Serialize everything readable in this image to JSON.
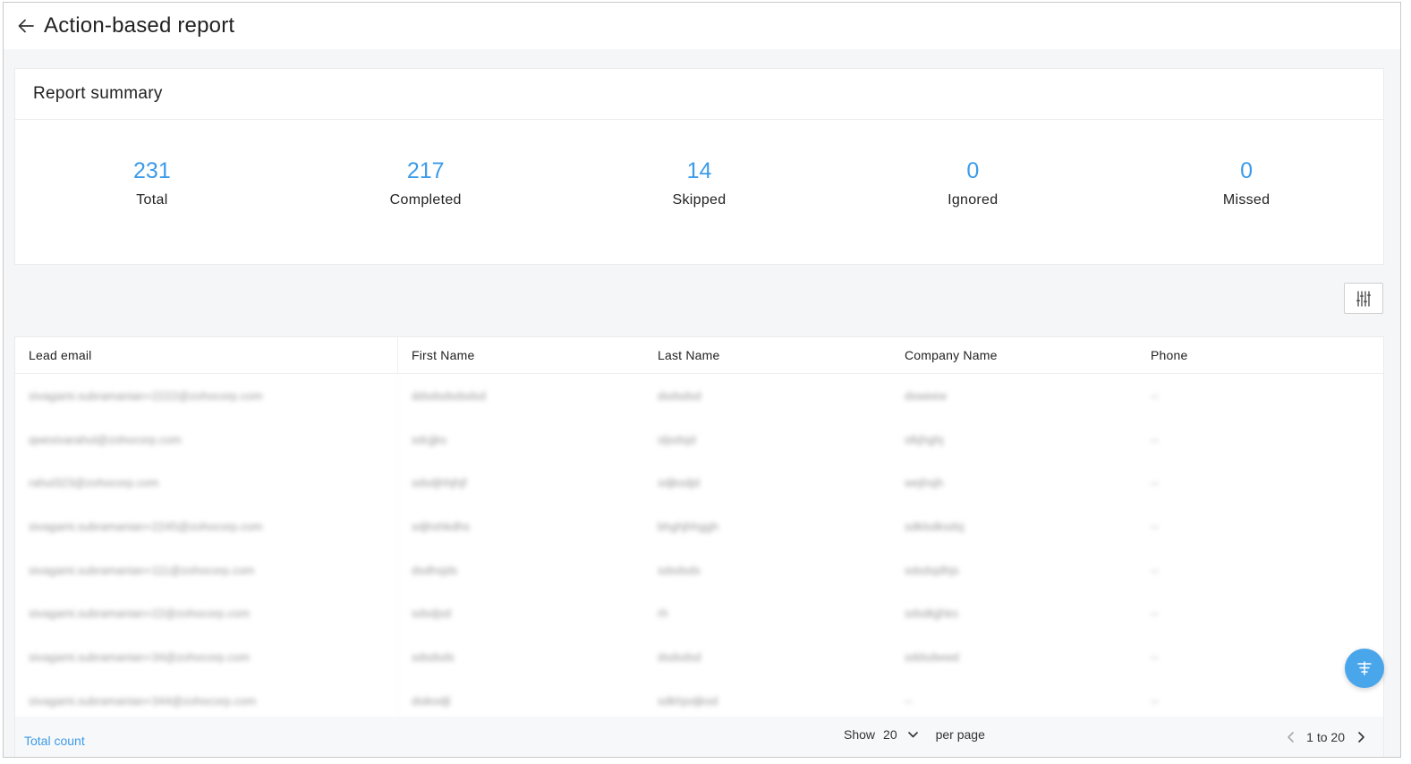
{
  "header": {
    "title": "Action-based report",
    "back_icon": "arrow-left-icon"
  },
  "summary": {
    "title": "Report summary",
    "stats": [
      {
        "value": "231",
        "label": "Total"
      },
      {
        "value": "217",
        "label": "Completed"
      },
      {
        "value": "14",
        "label": "Skipped"
      },
      {
        "value": "0",
        "label": "Ignored"
      },
      {
        "value": "0",
        "label": "Missed"
      }
    ]
  },
  "table": {
    "columns": [
      "Lead email",
      "First Name",
      "Last Name",
      "Company Name",
      "Phone"
    ],
    "rows": [
      [
        "sivagami.subramanian+2222@zohocorp.com",
        "ddsdsdsdsdsd",
        "dsdsdsd",
        "dsweew",
        "--"
      ],
      [
        "qwesivarahul@zohocorp.com",
        "sdcjjks",
        "sljsdsjd",
        "slkjhghj",
        "--"
      ],
      [
        "rahul323@zohocorp.com",
        "sdsdjhhjhjf",
        "sdjksdjd",
        "wejhsjh",
        "--"
      ],
      [
        "sivagami.subramanian+2245@zohocorp.com",
        "sdjhshkdhs",
        "bhghjhhggh",
        "sdklsdksdsj",
        "--"
      ],
      [
        "sivagami.subramanian+111@zohocorp.com",
        "dsdhsjds",
        "sdsdsds",
        "sdsdsjdhjs",
        "--"
      ],
      [
        "sivagami.subramanian+22@zohocorp.com",
        "sdsdjsd",
        "rh",
        "sdsdkjjhks",
        "--"
      ],
      [
        "sivagami.subramanian+34@zohocorp.com",
        "sdsdsds",
        "dsdsdsd",
        "sddsdwwd",
        "--"
      ],
      [
        "sivagami.subramanian+344@zohocorp.com",
        "dsikodjl",
        "sdkhjsdjksd",
        "--",
        "--"
      ]
    ]
  },
  "footer": {
    "total_count": "Total count",
    "show_label": "Show",
    "per_page_value": "20",
    "per_page_label": "per page",
    "range": "1 to 20"
  },
  "colors": {
    "accent": "#3c9be8",
    "fab": "#49a6ea"
  }
}
